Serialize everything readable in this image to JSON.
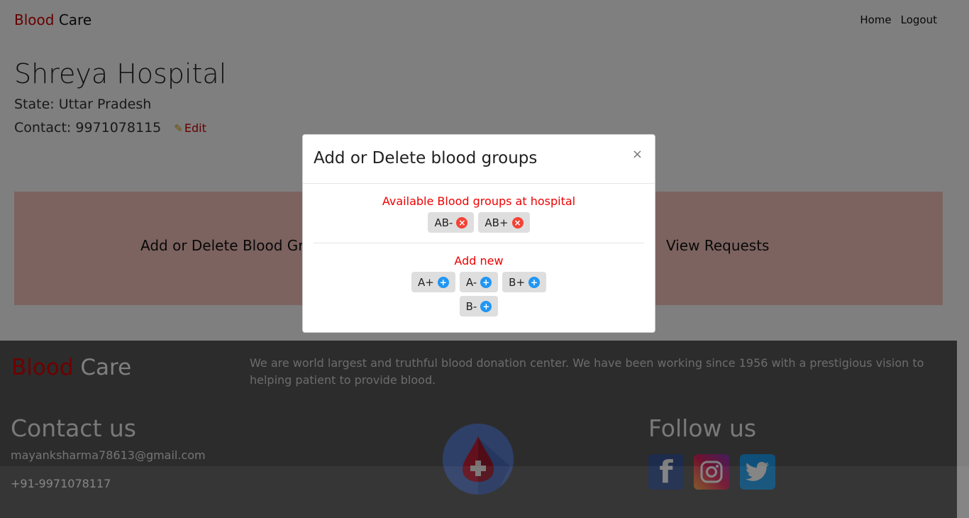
{
  "navbar": {
    "brand_first": "Blood",
    "brand_second": "Care",
    "links": [
      "Home",
      "Logout"
    ]
  },
  "hospital": {
    "name": "Shreya Hospital",
    "state": "State: Uttar Pradesh",
    "contact": "Contact: 9971078115",
    "edit_label": "Edit"
  },
  "actions": {
    "left_label": "Add or Delete Blood Gr",
    "right_label": "View Requests"
  },
  "footer": {
    "brand_first": "Blood",
    "brand_second": "Care",
    "description": "We are world largest and truthful blood donation center. We have been working since 1956 with a prestigious vision to helping patient to provide blood.",
    "contact_title": "Contact us",
    "email": "mayanksharma78613@gmail.com",
    "phone": "+91-9971078117",
    "follow_title": "Follow us",
    "social_icons": [
      "facebook-icon",
      "instagram-icon",
      "twitter-icon"
    ]
  },
  "modal": {
    "title": "Add or Delete blood groups",
    "close": "×",
    "available_title": "Available Blood groups at hospital",
    "available_groups": [
      "AB-",
      "AB+"
    ],
    "add_title": "Add new",
    "add_groups_row1": [
      "A+",
      "A-",
      "B+"
    ],
    "add_groups_row2": [
      "B-"
    ]
  },
  "colors": {
    "brand_red": "#cc0000",
    "panel_pink": "#f8c6c0",
    "delete_red": "#f44336",
    "add_blue": "#2196f3",
    "footer_bg": "#585858"
  }
}
